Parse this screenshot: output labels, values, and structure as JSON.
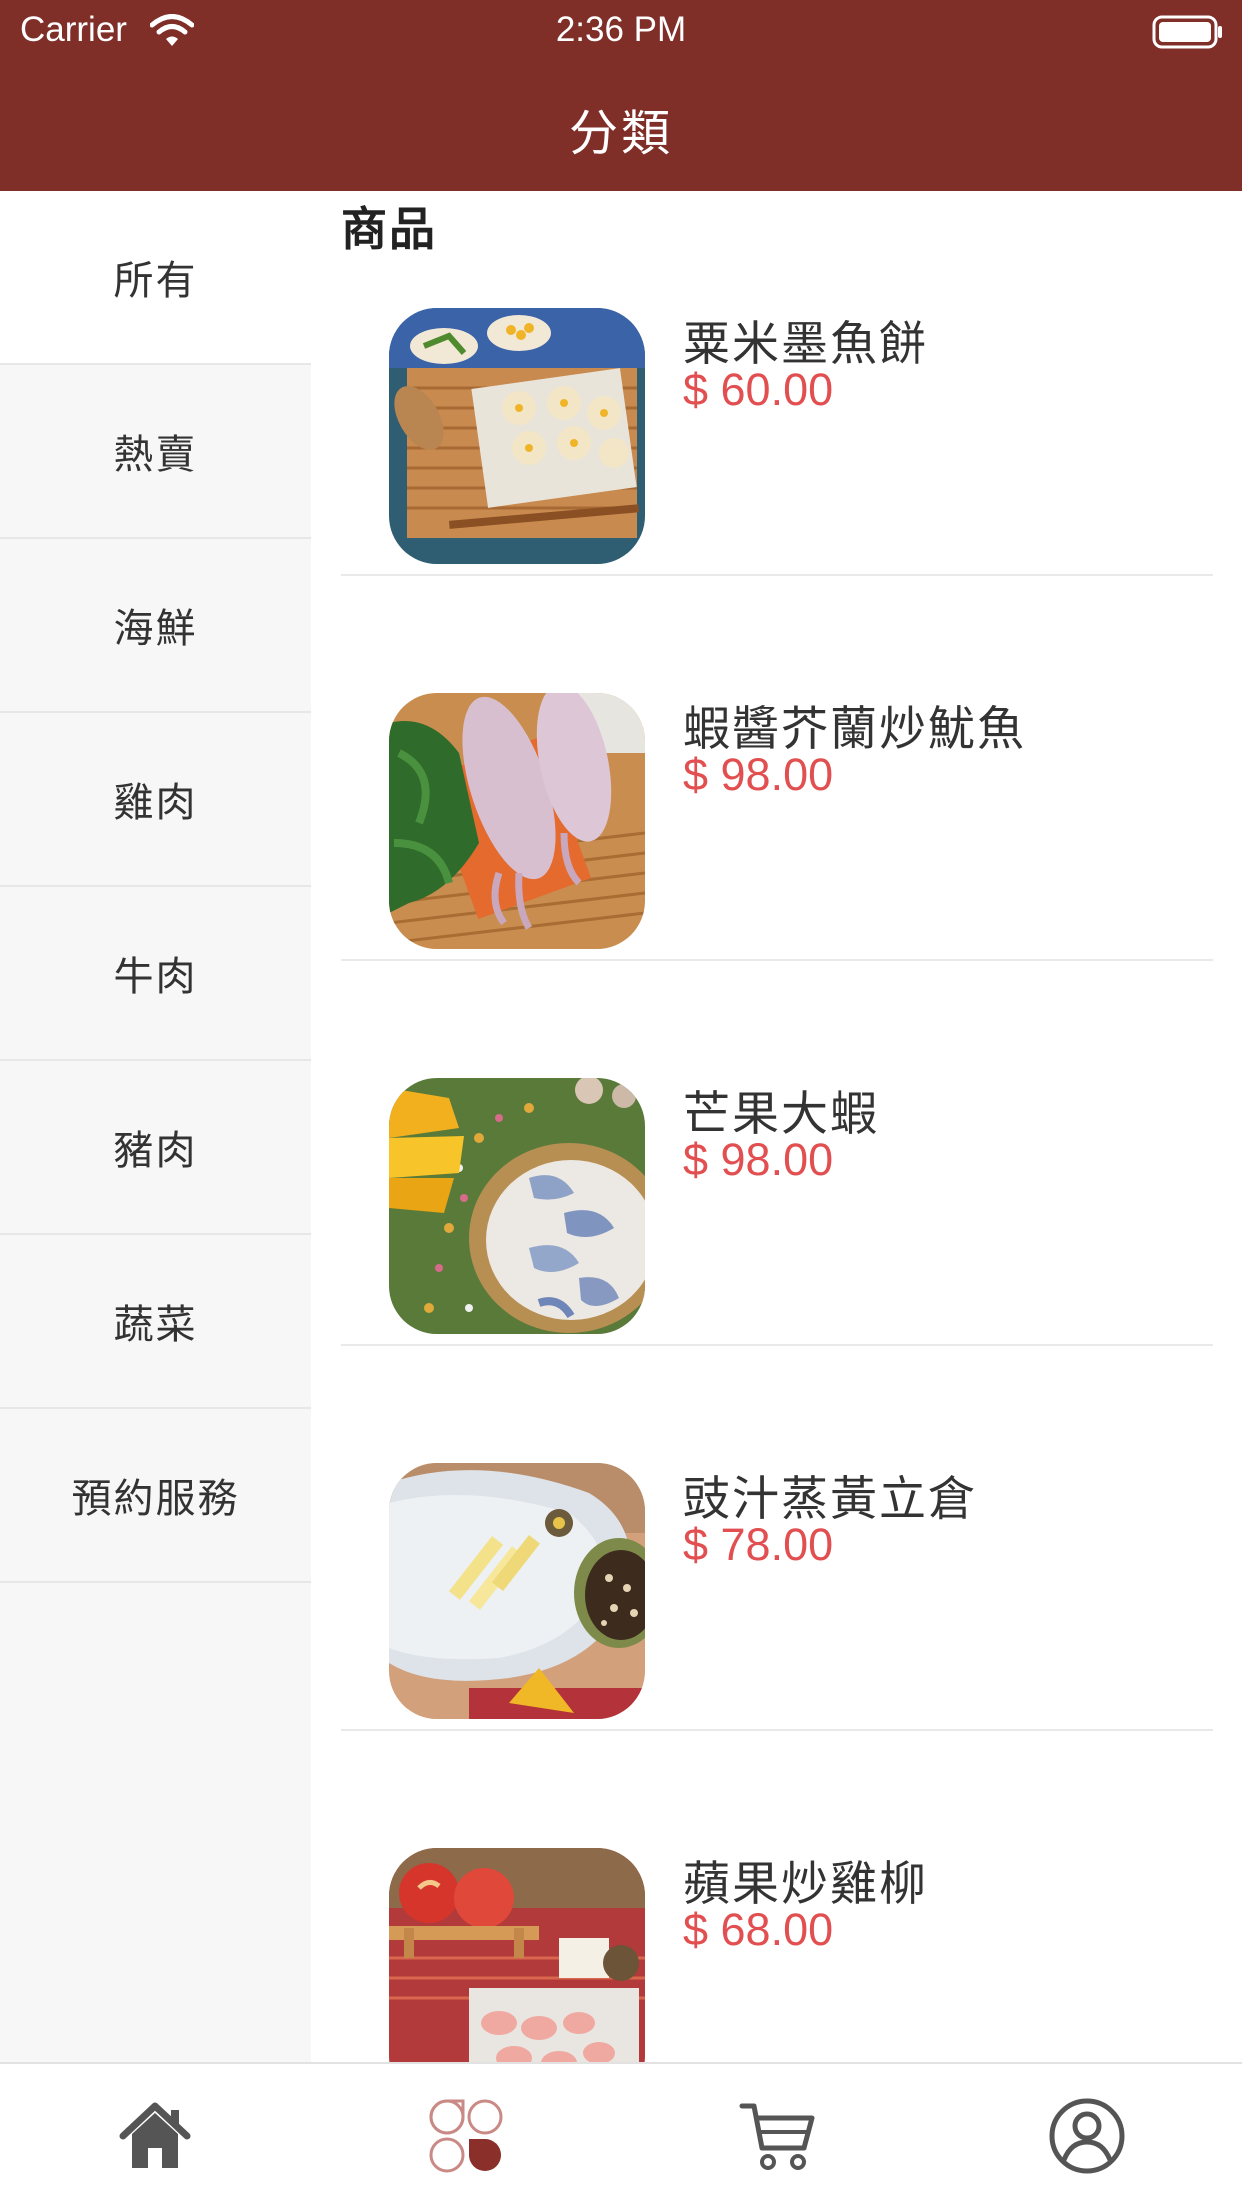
{
  "status_bar": {
    "carrier": "Carrier",
    "time": "2:36 PM"
  },
  "nav": {
    "title": "分類"
  },
  "sidebar": {
    "items": [
      {
        "label": "所有",
        "active": true
      },
      {
        "label": "熱賣",
        "active": false
      },
      {
        "label": "海鮮",
        "active": false
      },
      {
        "label": "雞肉",
        "active": false
      },
      {
        "label": "牛肉",
        "active": false
      },
      {
        "label": "豬肉",
        "active": false
      },
      {
        "label": "蔬菜",
        "active": false
      },
      {
        "label": "預約服務",
        "active": false
      }
    ]
  },
  "content": {
    "section_title": "商品",
    "products": [
      {
        "name": "粟米墨魚餅",
        "price": "$ 60.00"
      },
      {
        "name": "蝦醬芥蘭炒魷魚",
        "price": "$ 98.00"
      },
      {
        "name": "芒果大蝦",
        "price": "$ 98.00"
      },
      {
        "name": "豉汁蒸黃立倉",
        "price": "$ 78.00"
      },
      {
        "name": "蘋果炒雞柳",
        "price": "$ 68.00"
      }
    ]
  },
  "tabbar": {
    "tabs": [
      {
        "icon": "home-icon",
        "active": false
      },
      {
        "icon": "category-icon",
        "active": true
      },
      {
        "icon": "cart-icon",
        "active": false
      },
      {
        "icon": "profile-icon",
        "active": false
      }
    ]
  },
  "colors": {
    "brand": "#7f2e28",
    "price": "#e24f50",
    "sidebar_bg": "#f7f7f7",
    "tab_icon": "#555555",
    "tab_active": "#8b2f2a"
  }
}
